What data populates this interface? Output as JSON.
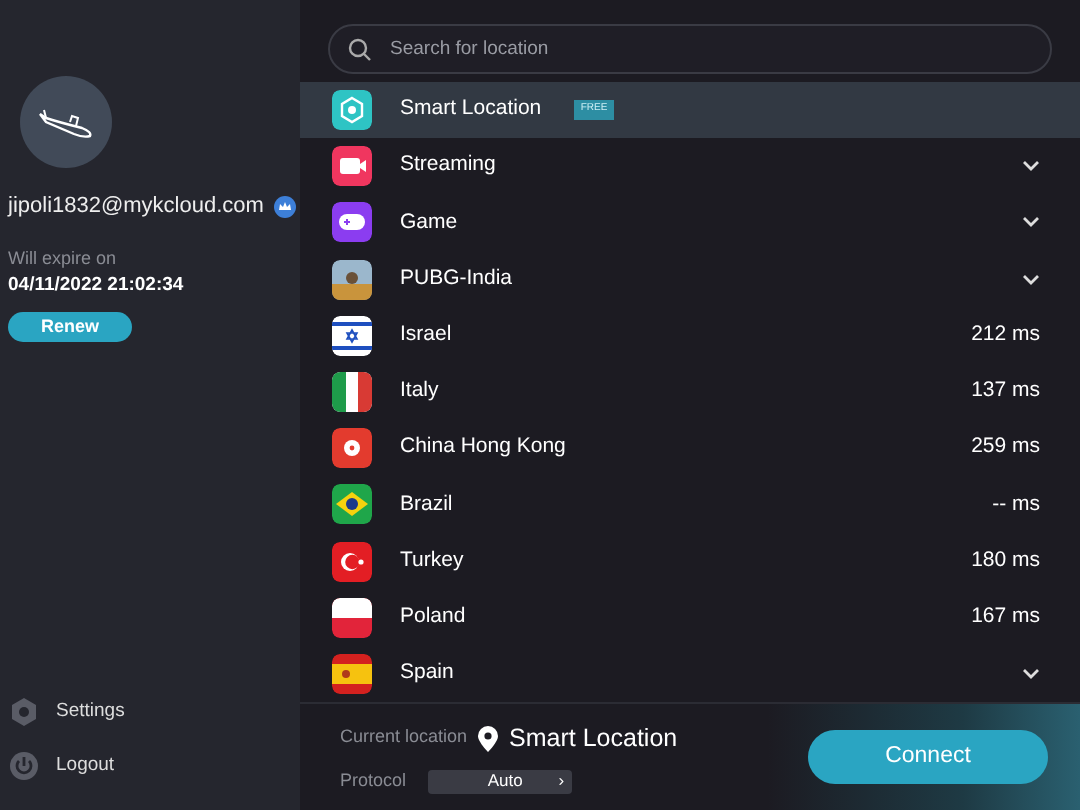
{
  "account": {
    "email": "jipoli1832@mykcloud.com",
    "expire_label": "Will expire on",
    "expire_date": "04/11/2022 21:02:34",
    "renew_button": "Renew"
  },
  "sidebar_menu": [
    "Settings",
    "Logout"
  ],
  "search": {
    "placeholder": "Search for location"
  },
  "locations": [
    {
      "kind": "smart",
      "name": "Smart Location",
      "badge": "FREE",
      "selected": true
    },
    {
      "kind": "streaming",
      "name": "Streaming",
      "selected": false
    },
    {
      "kind": "game",
      "name": "Game",
      "selected": false
    },
    {
      "kind": "pubg",
      "name": "PUBG-India",
      "selected": false
    },
    {
      "kind": "israel",
      "name": "Israel",
      "ping": "212 ms",
      "selected": false
    },
    {
      "kind": "italy",
      "name": "Italy",
      "ping": "137 ms",
      "selected": false
    },
    {
      "kind": "hongkong",
      "name": "China Hong Kong",
      "ping": "259 ms",
      "selected": false
    },
    {
      "kind": "brazil",
      "name": "Brazil",
      "ping": "-- ms",
      "selected": false
    },
    {
      "kind": "turkey",
      "name": "Turkey",
      "ping": "180 ms",
      "selected": false
    },
    {
      "kind": "poland",
      "name": "Poland",
      "ping": "167 ms",
      "selected": false
    },
    {
      "kind": "spain",
      "name": "Spain",
      "selected": false
    }
  ],
  "status": {
    "current_label": "Current location",
    "current_value": "Smart Location",
    "protocol_label": "Protocol",
    "protocol_value": "Auto",
    "chevron": "›",
    "connect_button": "Connect"
  }
}
